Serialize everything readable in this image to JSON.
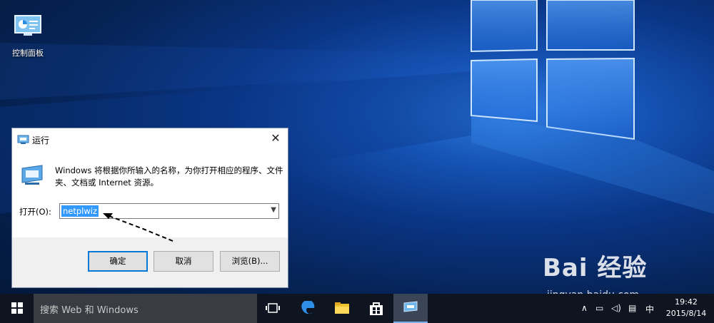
{
  "desktop": {
    "icon_label": "控制面板",
    "icon_name": "control-panel-icon"
  },
  "run_dialog": {
    "title": "运行",
    "close_symbol": "✕",
    "description": "Windows 将根据你所输入的名称，为你打开相应的程序、文件夹、文档或 Internet 资源。",
    "open_label": "打开(O):",
    "open_value": "netplwiz",
    "buttons": {
      "ok": "确定",
      "cancel": "取消",
      "browse": "浏览(B)..."
    }
  },
  "taskbar": {
    "search_placeholder": "搜索 Web 和 Windows",
    "apps": [
      "task-view-icon",
      "edge-icon",
      "file-explorer-icon",
      "store-icon",
      "run-icon"
    ],
    "tray_ime": "中",
    "clock_time": "19:42",
    "clock_date": "2015/8/14"
  },
  "watermark": {
    "brand": "Bai  经验",
    "url": "jingyan.baidu.com"
  },
  "colors": {
    "accent": "#0078d7",
    "selection": "#3399ff",
    "taskbar": "#0e1521"
  }
}
